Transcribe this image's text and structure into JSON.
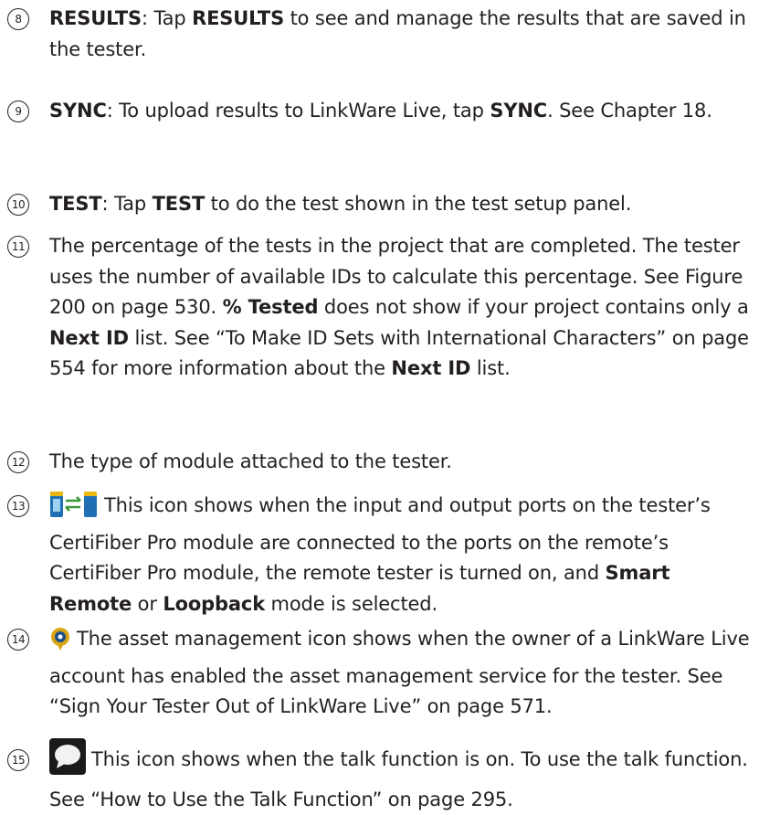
{
  "items": [
    {
      "n": "8",
      "bold": "RESULTS",
      "a": ": Tap ",
      "bold2": "RESULTS",
      "b": " to see and manage the results that are saved in the tester."
    },
    {
      "n": "9",
      "bold": "SYNC",
      "a": ": To upload results to LinkWare Live, tap ",
      "bold2": "SYNC",
      "b": ". See Chapter 18."
    },
    {
      "n": "10",
      "bold": "TEST",
      "a": ": Tap ",
      "bold2": "TEST",
      "b": " to do the test shown in the test setup panel."
    },
    {
      "n": "11",
      "a": "The percentage of the tests in the project that are completed. The tester uses the number of available IDs to calculate this percentage. See Figure 200 on page 530. ",
      "bold": "% Tested",
      "b": " does not show if your project contains only a ",
      "bold2": "Next ID",
      "c": " list. See “To Make ID Sets with International Characters” on page 554 for more information about the ",
      "bold3": "Next ID",
      "d": " list."
    },
    {
      "n": "12",
      "a": "The type of module attached to the tester."
    },
    {
      "n": "13",
      "icon": "remote-connected-icon",
      "a": "This icon shows when the input and output ports on the tester’s CertiFiber Pro module are connected to the ports on the remote’s CertiFiber Pro module, the remote tester is turned on, and ",
      "bold": "Smart Remote",
      "b": " or ",
      "bold2": "Loopback",
      "c": " mode is selected."
    },
    {
      "n": "14",
      "icon": "asset-management-icon",
      "a": "The asset management icon shows when the owner of a LinkWare Live account has enabled the asset management service for the tester. See “Sign Your Tester Out of LinkWare Live” on page 571."
    },
    {
      "n": "15",
      "icon": "talk-icon",
      "a": "This icon shows when the talk function is on. To use the talk function. See “How to Use the Talk Function” on page 295."
    }
  ]
}
